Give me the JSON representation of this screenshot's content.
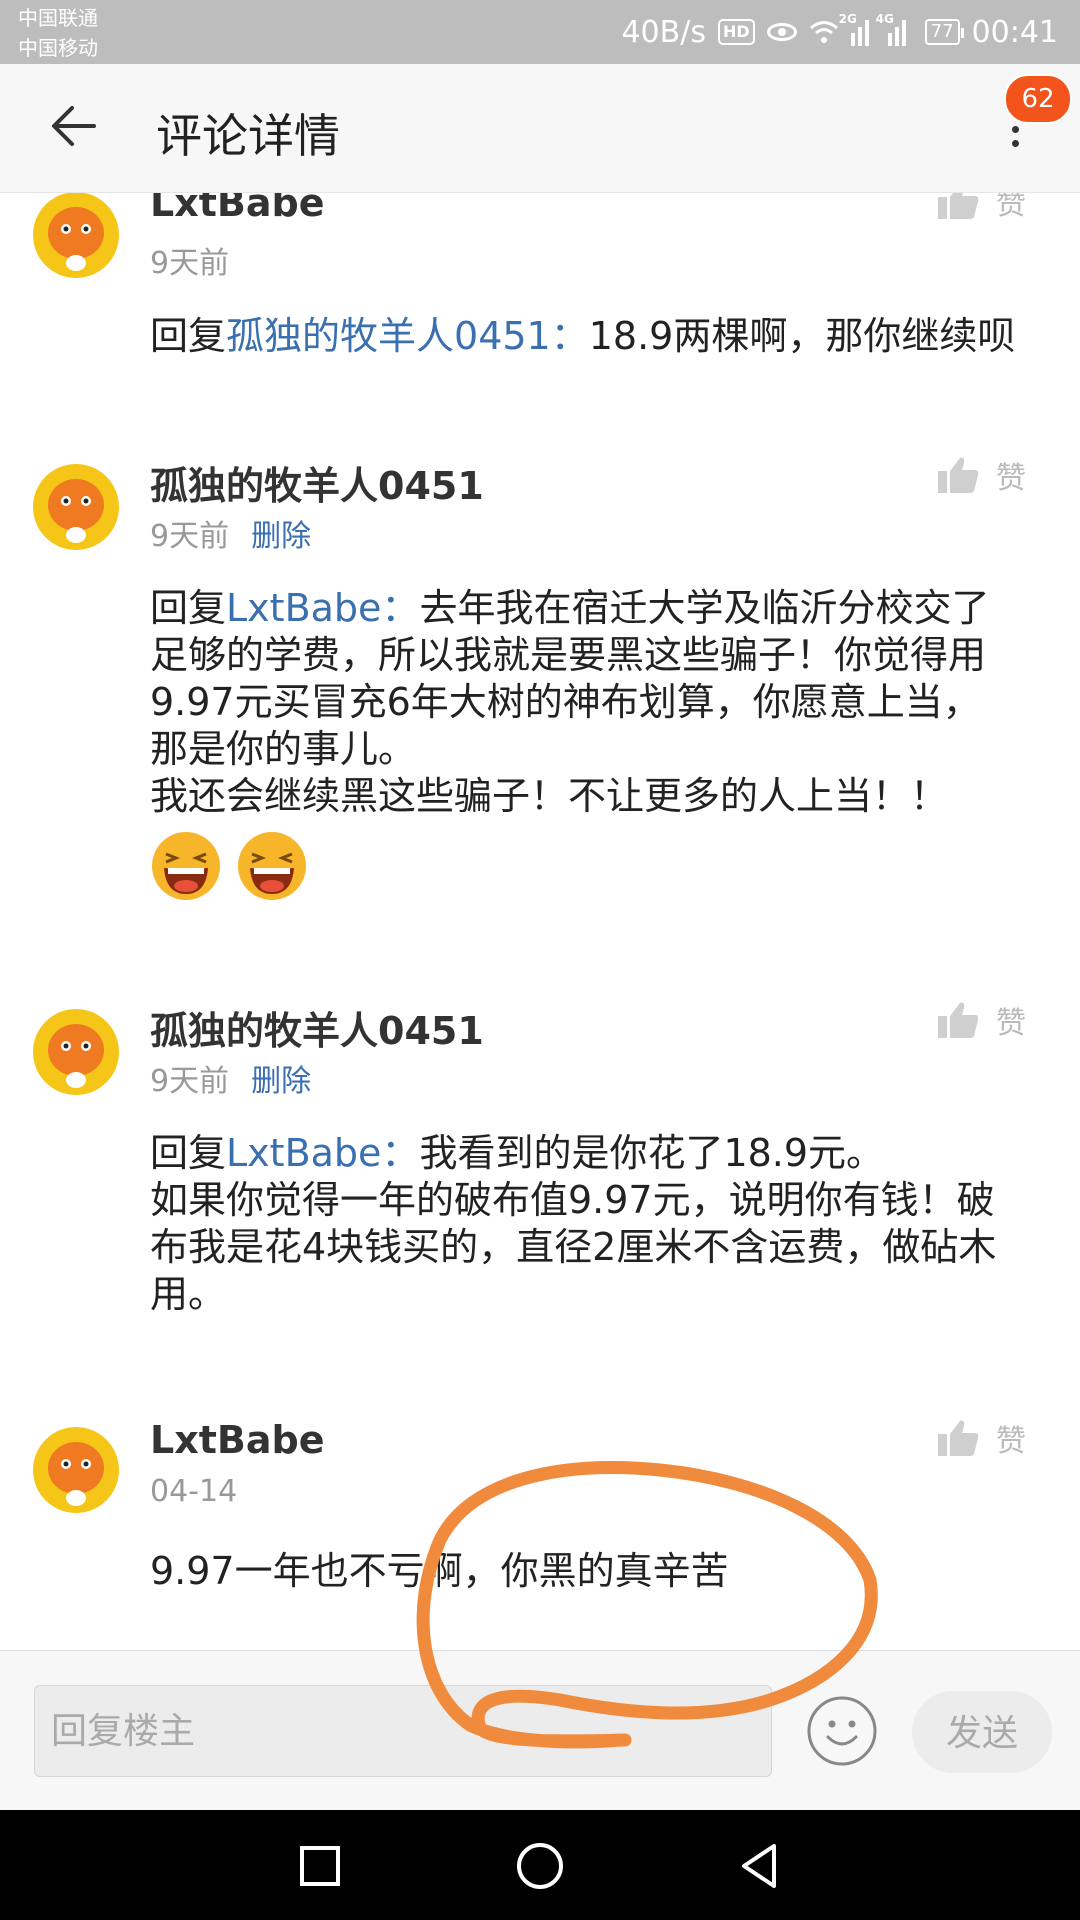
{
  "status_bar": {
    "carrier_1": "中国联通",
    "carrier_2": "中国移动",
    "net_speed": "40B/s",
    "hd_label": "HD",
    "signal_1_tag": "2G",
    "signal_2_tag": "4G",
    "battery": "77",
    "time": "00:41"
  },
  "header": {
    "title": "评论详情",
    "badge_count": "62"
  },
  "comments": [
    {
      "user": "LxtBabe",
      "time": "9天前",
      "reply_prefix": "回复",
      "reply_to": "孤独的牧羊人0451：",
      "text": "18.9两棵啊，那你继续呗",
      "like_label": "赞"
    },
    {
      "user": "孤独的牧羊人0451",
      "time": "9天前",
      "delete_label": "删除",
      "reply_prefix": "回复",
      "reply_to": "LxtBabe：",
      "text_lines": [
        "去年我在宿迁大学及临沂分校交了",
        "足够的学费，所以我就是要黑这些骗子！你觉得用",
        "9.97元买冒充6年大树的神布划算，你愿意上当，",
        "那是你的事儿。",
        "我还会继续黑这些骗子！不让更多的人上当！！"
      ],
      "emojis": [
        "laughing-emoji",
        "laughing-emoji"
      ],
      "like_label": "赞"
    },
    {
      "user": "孤独的牧羊人0451",
      "time": "9天前",
      "delete_label": "删除",
      "reply_prefix": "回复",
      "reply_to": "LxtBabe：",
      "text_lines": [
        "我看到的是你花了18.9元。",
        "如果你觉得一年的破布值9.97元，说明你有钱！破",
        "布我是花4块钱买的，直径2厘米不含运费，做砧木",
        "用。"
      ],
      "like_label": "赞"
    },
    {
      "user": "LxtBabe",
      "time": "04-14",
      "text": "9.97一年也不亏啊，你黑的真辛苦",
      "like_label": "赞"
    }
  ],
  "input_bar": {
    "placeholder": "回复楼主",
    "send_label": "发送"
  },
  "colors": {
    "link": "#3a6fb0",
    "badge": "#f2541b",
    "scribble": "#f08a3c",
    "avatar_ring": "#f5c518"
  }
}
